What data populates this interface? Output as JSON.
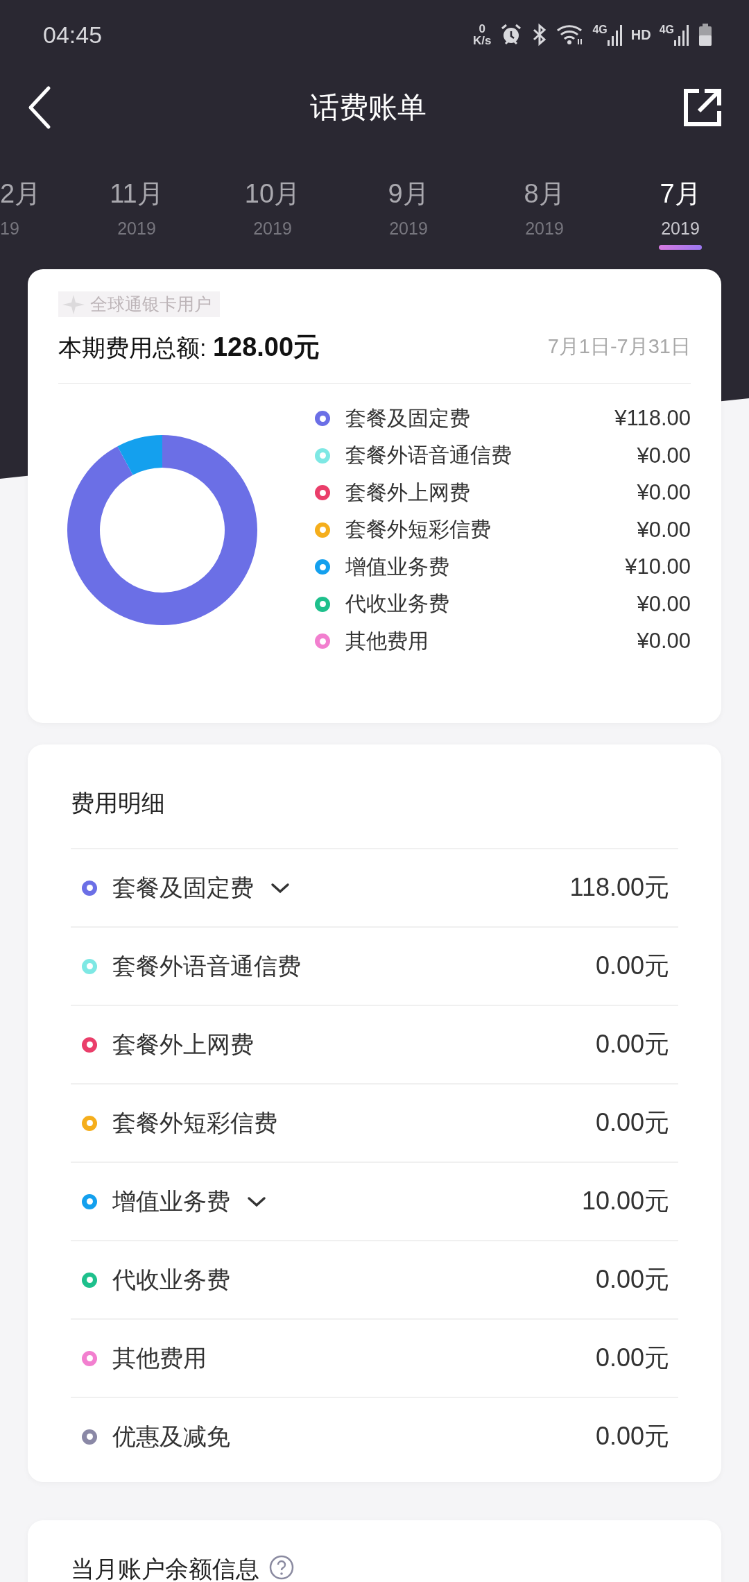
{
  "status_bar": {
    "time": "04:45",
    "net_speed": "0",
    "net_unit": "K/s",
    "sim1": "4G",
    "hd": "HD",
    "sim2": "4G"
  },
  "header": {
    "title": "话费账单"
  },
  "months": [
    {
      "month": "2月",
      "year": "19",
      "selected": false
    },
    {
      "month": "11月",
      "year": "2019",
      "selected": false
    },
    {
      "month": "10月",
      "year": "2019",
      "selected": false
    },
    {
      "month": "9月",
      "year": "2019",
      "selected": false
    },
    {
      "month": "8月",
      "year": "2019",
      "selected": false
    },
    {
      "month": "7月",
      "year": "2019",
      "selected": true
    }
  ],
  "summary": {
    "badge": "全球通银卡用户",
    "total": "本期费用总额: **128.00元**",
    "period": "7月1日-7月31日",
    "chart_data": {
      "type": "donut",
      "categories": [
        "套餐及固定费",
        "套餐外语音通信费",
        "套餐外上网费",
        "套餐外短彩信费",
        "增值业务费",
        "代收业务费",
        "其他费用"
      ],
      "values": [
        92.19,
        0,
        0,
        0,
        7.81,
        0,
        0
      ]
    },
    "legend": [
      {
        "amount": "¥118.00",
        "color": "#6b6fe6"
      },
      {
        "amount": "¥0.00",
        "color": "#7ee8e4"
      },
      {
        "amount": "¥0.00",
        "color": "#ea3e6a"
      },
      {
        "amount": "¥0.00",
        "color": "#f5ae1c"
      },
      {
        "amount": "¥10.00",
        "color": "#14a0ee"
      },
      {
        "amount": "¥0.00",
        "color": "#1ec08c"
      },
      {
        "amount": "¥0.00",
        "color": "#f27fcf"
      }
    ]
  },
  "details": {
    "title": "费用明细",
    "rows": [
      {
        "label": "套餐及固定费",
        "amount": "118.00元",
        "color": "#6b6fe6",
        "expandable": true
      },
      {
        "label": "套餐外语音通信费",
        "amount": "0.00元",
        "color": "#7ee8e4",
        "expandable": false
      },
      {
        "label": "套餐外上网费",
        "amount": "0.00元",
        "color": "#ea3e6a",
        "expandable": false
      },
      {
        "label": "套餐外短彩信费",
        "amount": "0.00元",
        "color": "#f5ae1c",
        "expandable": false
      },
      {
        "label": "增值业务费",
        "amount": "10.00元",
        "color": "#14a0ee",
        "expandable": true
      },
      {
        "label": "代收业务费",
        "amount": "0.00元",
        "color": "#1ec08c",
        "expandable": false
      },
      {
        "label": "其他费用",
        "amount": "0.00元",
        "color": "#f27fcf",
        "expandable": false
      },
      {
        "label": "优惠及减免",
        "amount": "0.00元",
        "color": "#8a88a6",
        "expandable": false
      }
    ]
  },
  "balance": {
    "title": "当月账户余额信息"
  }
}
